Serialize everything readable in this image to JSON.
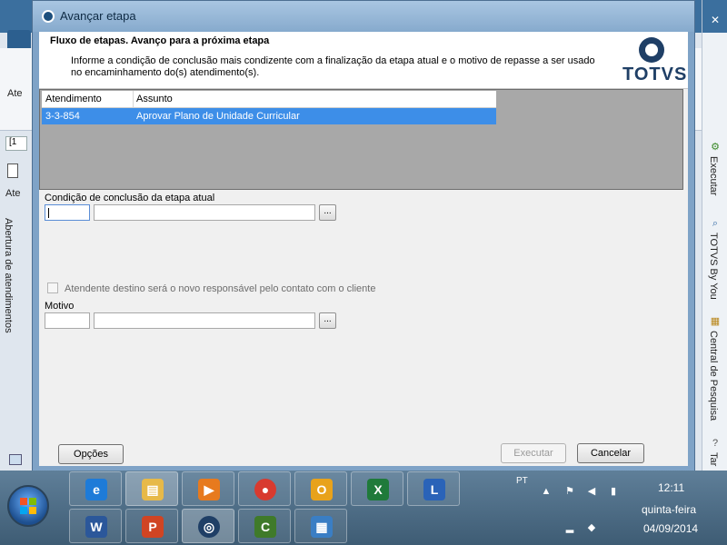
{
  "background": {
    "left_label_1": "Ate",
    "tab_label": "[1",
    "left_label_2": "Ate",
    "vertical_label": "Abertura de atendimentos"
  },
  "right_panel": {
    "items": [
      {
        "label": "Executar",
        "icon": "gear-icon"
      },
      {
        "label": "TOTVS By You",
        "icon": "search-icon"
      },
      {
        "label": "Central de Pesquisa",
        "icon": "grid-icon"
      },
      {
        "label": "Tar",
        "icon": "help-icon"
      }
    ]
  },
  "dialog": {
    "title": "Avançar etapa",
    "header_title": "Fluxo de etapas. Avanço para a próxima etapa",
    "header_description": "Informe a condição de conclusão mais condizente com a finalização da etapa atual e o motivo de repasse a ser usado no encaminhamento do(s) atendimento(s).",
    "logo_text": "TOTVS",
    "table": {
      "columns": [
        "Atendimento",
        "Assunto"
      ],
      "rows": [
        {
          "atendimento": "3-3-854",
          "assunto": "Aprovar Plano de Unidade Curricular"
        }
      ]
    },
    "condition_label": "Condição de conclusão da etapa atual",
    "condition_code": "",
    "condition_desc": "",
    "lookup_label": "...",
    "checkbox_label": "Atendente destino será o novo responsável pelo contato com o cliente",
    "checkbox_checked": false,
    "motivo_label": "Motivo",
    "motivo_code": "",
    "motivo_desc": "",
    "buttons": {
      "options": "Opções",
      "execute": "Executar",
      "cancel": "Cancelar"
    }
  },
  "taskbar": {
    "language": "PT",
    "time": "12:11",
    "weekday": "quinta-feira",
    "date": "04/09/2014",
    "apps_row1": [
      {
        "name": "internet-explorer",
        "glyph": "e",
        "color": "#1e7bd8"
      },
      {
        "name": "file-explorer",
        "glyph": "▤",
        "color": "#e7b948"
      },
      {
        "name": "media-player",
        "glyph": "▶",
        "color": "#e77a1e"
      },
      {
        "name": "chrome",
        "glyph": "●",
        "color": "#d83a2f"
      },
      {
        "name": "outlook",
        "glyph": "O",
        "color": "#e8a21b"
      },
      {
        "name": "excel",
        "glyph": "X",
        "color": "#1f7a3a"
      },
      {
        "name": "lync",
        "glyph": "L",
        "color": "#2a63b8"
      }
    ],
    "apps_row2": [
      {
        "name": "word",
        "glyph": "W",
        "color": "#2b579a"
      },
      {
        "name": "powerpoint",
        "glyph": "P",
        "color": "#d04423"
      },
      {
        "name": "totvs",
        "glyph": "◎",
        "color": "#1f3f66"
      },
      {
        "name": "camtasia",
        "glyph": "C",
        "color": "#3f7a2a"
      },
      {
        "name": "control-panel",
        "glyph": "▦",
        "color": "#3a7ec4"
      }
    ]
  }
}
